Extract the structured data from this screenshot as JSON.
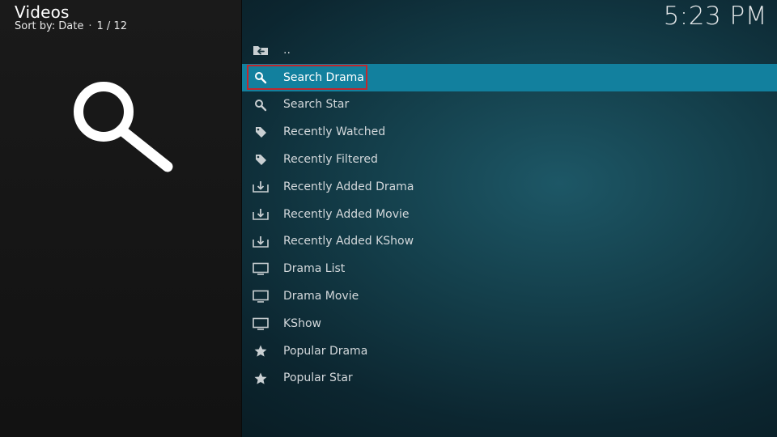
{
  "header": {
    "title": "Videos",
    "sort_label": "Sort by: Date",
    "separator": "·",
    "position": "1 / 12"
  },
  "clock": "5:23 PM",
  "colors": {
    "focus_bar": "#12809e",
    "focus_border": "#c0282d",
    "background_teal": "#1d5766"
  },
  "list": {
    "items": [
      {
        "label": "..",
        "icon": "parent-folder-icon"
      },
      {
        "label": "Search Drama",
        "icon": "search-icon",
        "focused": true
      },
      {
        "label": "Search Star",
        "icon": "search-icon"
      },
      {
        "label": "Recently Watched",
        "icon": "tag-icon"
      },
      {
        "label": "Recently Filtered",
        "icon": "tag-icon"
      },
      {
        "label": "Recently Added Drama",
        "icon": "download-tray-icon"
      },
      {
        "label": "Recently Added Movie",
        "icon": "download-tray-icon"
      },
      {
        "label": "Recently Added KShow",
        "icon": "download-tray-icon"
      },
      {
        "label": "Drama List",
        "icon": "monitor-icon"
      },
      {
        "label": "Drama Movie",
        "icon": "monitor-icon"
      },
      {
        "label": "KShow",
        "icon": "monitor-icon"
      },
      {
        "label": "Popular Drama",
        "icon": "star-icon"
      },
      {
        "label": "Popular Star",
        "icon": "star-icon"
      }
    ]
  }
}
